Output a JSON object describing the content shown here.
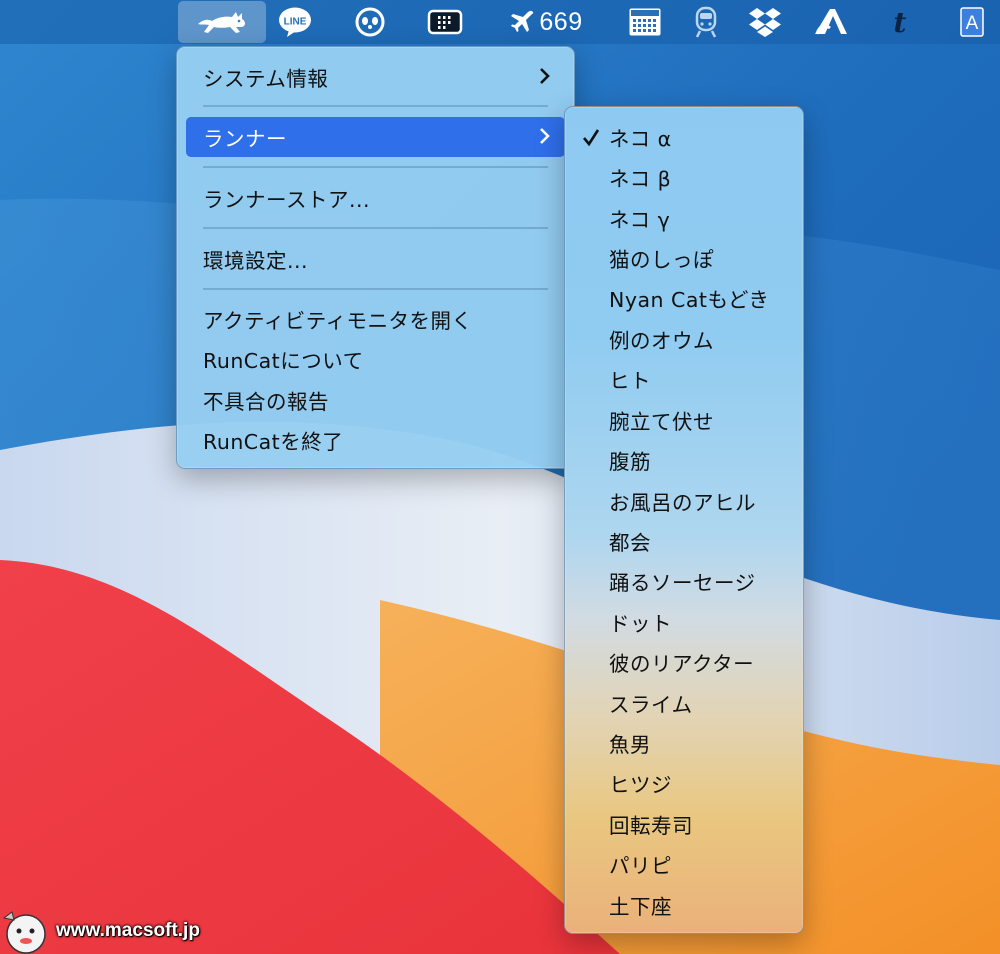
{
  "menubar": {
    "items": [
      {
        "id": "runcat",
        "icon": "running-cat-icon"
      },
      {
        "id": "line",
        "icon": "line-icon",
        "text": "LINE"
      },
      {
        "id": "panda",
        "icon": "panda-icon"
      },
      {
        "id": "grid",
        "icon": "grid-window-icon"
      },
      {
        "id": "flight",
        "icon": "airplane-icon",
        "text": "669"
      },
      {
        "id": "calendar",
        "icon": "calendar-icon"
      },
      {
        "id": "train",
        "icon": "train-icon"
      },
      {
        "id": "dropbox",
        "icon": "dropbox-icon"
      },
      {
        "id": "atok",
        "icon": "atok-icon"
      },
      {
        "id": "t",
        "icon": "t-app-icon",
        "text": "t"
      },
      {
        "id": "input",
        "icon": "input-source-icon",
        "text": "A"
      }
    ]
  },
  "main_menu": {
    "items": [
      {
        "label": "システム情報",
        "submenu": true
      },
      {
        "label": "ランナー",
        "submenu": true,
        "highlighted": true
      },
      {
        "label": "ランナーストア..."
      },
      {
        "label": "環境設定..."
      },
      {
        "label": "アクティビティモニタを開く"
      },
      {
        "label": "RunCatについて"
      },
      {
        "label": "不具合の報告"
      },
      {
        "label": "RunCatを終了"
      }
    ]
  },
  "runner_menu": {
    "items": [
      {
        "label": "ネコ α",
        "checked": true
      },
      {
        "label": "ネコ β"
      },
      {
        "label": "ネコ γ"
      },
      {
        "label": "猫のしっぽ"
      },
      {
        "label": "Nyan Catもどき"
      },
      {
        "label": "例のオウム"
      },
      {
        "label": "ヒト"
      },
      {
        "label": "腕立て伏せ"
      },
      {
        "label": "腹筋"
      },
      {
        "label": "お風呂のアヒル"
      },
      {
        "label": "都会"
      },
      {
        "label": "踊るソーセージ"
      },
      {
        "label": "ドット"
      },
      {
        "label": "彼のリアクター"
      },
      {
        "label": "スライム"
      },
      {
        "label": "魚男"
      },
      {
        "label": "ヒツジ"
      },
      {
        "label": "回転寿司"
      },
      {
        "label": "パリピ"
      },
      {
        "label": "土下座"
      }
    ]
  },
  "watermark": {
    "text": "www.macsoft.jp"
  },
  "colors": {
    "highlight": "#2f6fea",
    "menu_bg": "#96cef0",
    "wallpaper_red": "#ef3b3f",
    "wallpaper_orange": "#f5a13a"
  }
}
